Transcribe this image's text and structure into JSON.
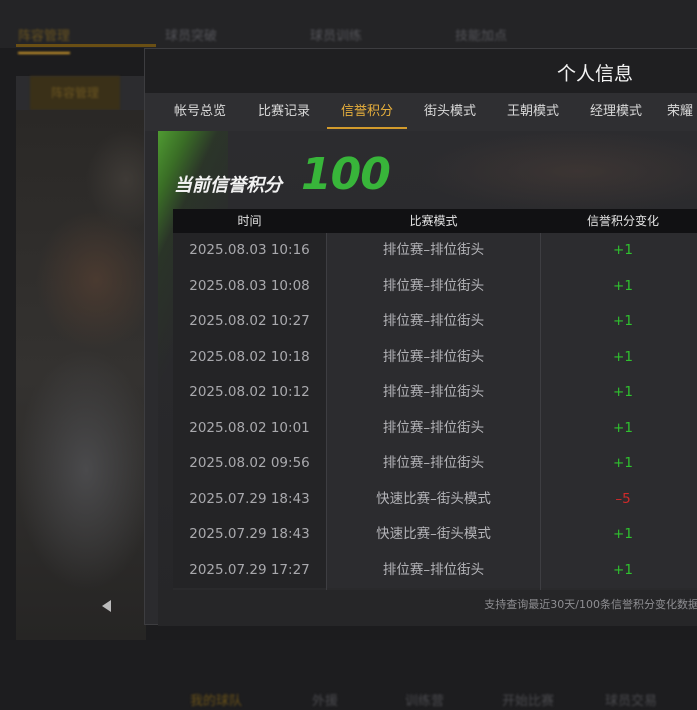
{
  "background": {
    "top_tabs": [
      "阵容管理",
      "球员突破",
      "球员训练",
      "技能加点"
    ],
    "sub_tab": "阵容管理",
    "bottom_nav": [
      "我的球队",
      "外援",
      "训练营",
      "开始比赛",
      "球员交易"
    ]
  },
  "modal": {
    "title": "个人信息",
    "tabs": [
      {
        "label": "帐号总览"
      },
      {
        "label": "比赛记录"
      },
      {
        "label": "信誉积分"
      },
      {
        "label": "街头模式"
      },
      {
        "label": "王朝模式"
      },
      {
        "label": "经理模式"
      },
      {
        "label": "荣耀"
      }
    ],
    "active_tab": "信誉积分",
    "score_label": "当前信誉积分",
    "score_value": "100",
    "table": {
      "headers": {
        "time": "时间",
        "mode": "比赛模式",
        "change": "信誉积分变化"
      },
      "rows": [
        {
          "time": "2025.08.03  10:16",
          "mode": "排位赛–排位街头",
          "change": "+1"
        },
        {
          "time": "2025.08.03  10:08",
          "mode": "排位赛–排位街头",
          "change": "+1"
        },
        {
          "time": "2025.08.02  10:27",
          "mode": "排位赛–排位街头",
          "change": "+1"
        },
        {
          "time": "2025.08.02  10:18",
          "mode": "排位赛–排位街头",
          "change": "+1"
        },
        {
          "time": "2025.08.02  10:12",
          "mode": "排位赛–排位街头",
          "change": "+1"
        },
        {
          "time": "2025.08.02  10:01",
          "mode": "排位赛–排位街头",
          "change": "+1"
        },
        {
          "time": "2025.08.02  09:56",
          "mode": "排位赛–排位街头",
          "change": "+1"
        },
        {
          "time": "2025.07.29  18:43",
          "mode": "快速比赛–街头模式",
          "change": "–5"
        },
        {
          "time": "2025.07.29  18:43",
          "mode": "快速比赛–街头模式",
          "change": "+1"
        },
        {
          "time": "2025.07.29  17:27",
          "mode": "排位赛–排位街头",
          "change": "+1"
        }
      ]
    },
    "footnote": "支持查询最近30天/100条信誉积分变化数据"
  },
  "colors": {
    "accent_gold": "#e8b03c",
    "score_green": "#38b53a",
    "positive": "#2fc12f",
    "negative": "#cf2a2a"
  }
}
